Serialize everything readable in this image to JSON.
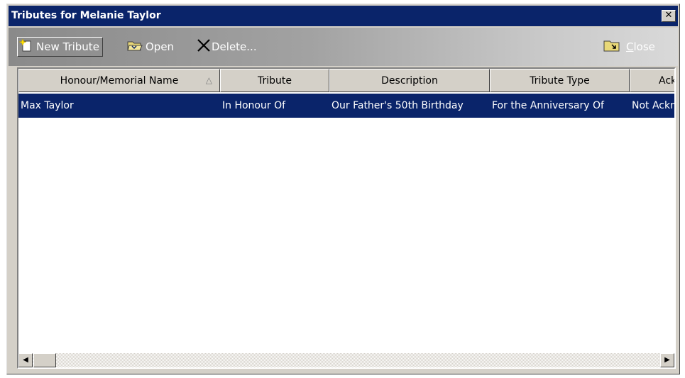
{
  "window": {
    "title": "Tributes for Melanie Taylor",
    "close_glyph": "✕"
  },
  "toolbar": {
    "new_tribute_label": "New Tribute",
    "open_label": "Open",
    "delete_label": "Delete...",
    "close_label_first": "C",
    "close_label_rest": "lose",
    "icons": {
      "new_tribute": "new-document-star-icon",
      "open": "open-folder-icon",
      "delete": "delete-x-icon",
      "close": "close-folder-icon"
    }
  },
  "list": {
    "columns": [
      {
        "label": "Honour/Memorial Name",
        "sorted": "ascending"
      },
      {
        "label": "Tribute"
      },
      {
        "label": "Description"
      },
      {
        "label": "Tribute Type"
      },
      {
        "label": "Ack"
      }
    ],
    "rows": [
      {
        "cells": [
          "Max Taylor",
          "In Honour Of",
          "Our Father's 50th Birthday",
          "For the Anniversary Of",
          "Not Ackn"
        ],
        "selected": true
      }
    ]
  },
  "scrollbar": {
    "left_arrow": "◀",
    "right_arrow": "▶"
  },
  "colors": {
    "title_bar": "#0a246a",
    "selection": "#0a246a",
    "window_face": "#d4d0c8"
  }
}
